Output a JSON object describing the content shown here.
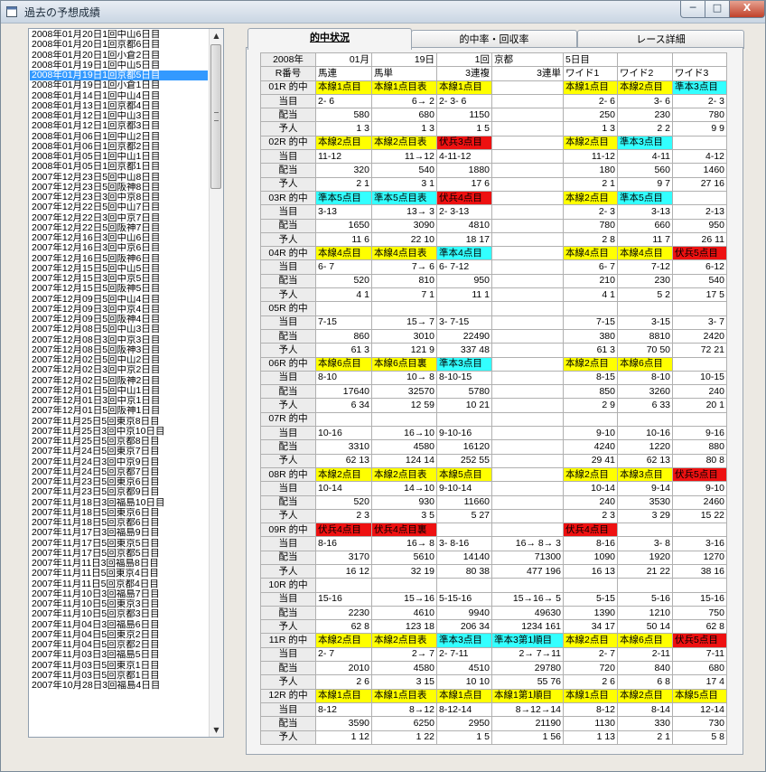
{
  "window": {
    "title": "過去の予想成績",
    "min_label": "─",
    "max_label": "□",
    "close_label": "X"
  },
  "race_list": [
    "2008年01月20日1回中山6日目",
    "2008年01月20日1回京都6日目",
    "2008年01月20日1回小倉2日目",
    "2008年01月19日1回中山5日目",
    "2008年01月19日1回京都5日目",
    "2008年01月19日1回小倉1日目",
    "2008年01月14日1回中山4日目",
    "2008年01月13日1回京都4日目",
    "2008年01月12日1回中山3日目",
    "2008年01月12日1回京都3日目",
    "2008年01月06日1回中山2日目",
    "2008年01月06日1回京都2日目",
    "2008年01月05日1回中山1日目",
    "2008年01月05日1回京都1日目",
    "2007年12月23日5回中山8日目",
    "2007年12月23日5回阪神8日目",
    "2007年12月23日3回中京8日目",
    "2007年12月22日5回中山7日目",
    "2007年12月22日3回中京7日目",
    "2007年12月22日5回阪神7日目",
    "2007年12月16日3回中山6日目",
    "2007年12月16日3回中京6日目",
    "2007年12月16日5回阪神6日目",
    "2007年12月15日5回中山5日目",
    "2007年12月15日3回中京5日目",
    "2007年12月15日5回阪神5日目",
    "2007年12月09日5回中山4日目",
    "2007年12月09日3回中京4日目",
    "2007年12月09日5回阪神4日目",
    "2007年12月08日5回中山3日目",
    "2007年12月08日3回中京3日目",
    "2007年12月08日5回阪神3日目",
    "2007年12月02日5回中山2日目",
    "2007年12月02日3回中京2日目",
    "2007年12月02日5回阪神2日目",
    "2007年12月01日5回中山1日目",
    "2007年12月01日3回中京1日目",
    "2007年12月01日5回阪神1日目",
    "2007年11月25日5回東京8日目",
    "2007年11月25日3回中京10日目",
    "2007年11月25日5回京都8日目",
    "2007年11月24日5回東京7日目",
    "2007年11月24日3回中京9日目",
    "2007年11月24日5回京都7日目",
    "2007年11月23日5回東京6日目",
    "2007年11月23日5回京都9日目",
    "2007年11月18日3回福島10日目",
    "2007年11月18日5回東京6日目",
    "2007年11月18日5回京都6日目",
    "2007年11月17日3回福島9日目",
    "2007年11月17日5回東京5日目",
    "2007年11月17日5回京都5日目",
    "2007年11月11日3回福島8日目",
    "2007年11月11日5回東京4日目",
    "2007年11月11日5回京都4日目",
    "2007年11月10日3回福島7日目",
    "2007年11月10日5回東京3日目",
    "2007年11月10日5回京都3日目",
    "2007年11月04日3回福島6日目",
    "2007年11月04日5回東京2日目",
    "2007年11月04日5回京都2日目",
    "2007年11月03日3回福島5日目",
    "2007年11月03日5回東京1日目",
    "2007年11月03日5回京都1日目",
    "2007年10月28日3回福島4日目"
  ],
  "selected_index": 4,
  "tabs": [
    {
      "label": "的中状況"
    },
    {
      "label": "的中率・回収率"
    },
    {
      "label": "レース詳細"
    }
  ],
  "header_rows": [
    [
      "2008年",
      "01月",
      "19日",
      "1回",
      "京都",
      "",
      "5日目",
      "",
      ""
    ],
    [
      "R番号",
      "馬連",
      "馬単",
      "3連複",
      "",
      "3連単",
      "ワイド1",
      "ワイド2",
      "ワイド3"
    ]
  ],
  "races": [
    {
      "label": "01R 的中",
      "hits": [
        [
          "y",
          "本線1点目"
        ],
        [
          "y",
          "本線1点目表"
        ],
        [
          "y",
          "本線1点目"
        ],
        [
          "",
          ""
        ],
        [
          "y",
          "本線1点目"
        ],
        [
          "y",
          "本線2点目"
        ],
        [
          "c",
          "準本3点目"
        ]
      ],
      "atari": [
        "2- 6",
        "6→ 2",
        "2- 3- 6",
        "",
        "2- 6",
        "3- 6",
        "2- 3"
      ],
      "haito": [
        "580",
        "680",
        "1150",
        "",
        "250",
        "230",
        "780"
      ],
      "ninki": [
        "1 3",
        "1 3",
        "1 5",
        "",
        "1 3",
        "2 2",
        "9 9"
      ]
    },
    {
      "label": "02R 的中",
      "hits": [
        [
          "y",
          "本線2点目"
        ],
        [
          "y",
          "本線2点目表"
        ],
        [
          "x",
          "伏兵3点目"
        ],
        [
          "",
          ""
        ],
        [
          "y",
          "本線2点目"
        ],
        [
          "c",
          "準本3点目"
        ],
        [
          "",
          ""
        ]
      ],
      "atari": [
        "11-12",
        "11→12",
        "4-11-12",
        "",
        "11-12",
        "4-11",
        "4-12"
      ],
      "haito": [
        "320",
        "540",
        "1880",
        "",
        "180",
        "560",
        "1460"
      ],
      "ninki": [
        "2 1",
        "3 1",
        "17 6",
        "",
        "2 1",
        "9 7",
        "27 16"
      ]
    },
    {
      "label": "03R 的中",
      "hits": [
        [
          "c",
          "準本5点目"
        ],
        [
          "c",
          "準本5点目表"
        ],
        [
          "x",
          "伏兵4点目"
        ],
        [
          "",
          ""
        ],
        [
          "y",
          "本線2点目"
        ],
        [
          "c",
          "準本5点目"
        ],
        [
          "",
          ""
        ]
      ],
      "atari": [
        "3-13",
        "13→ 3",
        "2- 3-13",
        "",
        "2- 3",
        "3-13",
        "2-13"
      ],
      "haito": [
        "1650",
        "3090",
        "4810",
        "",
        "780",
        "660",
        "950"
      ],
      "ninki": [
        "11 6",
        "22 10",
        "18 17",
        "",
        "2 8",
        "11 7",
        "26 11"
      ]
    },
    {
      "label": "04R 的中",
      "hits": [
        [
          "y",
          "本線4点目"
        ],
        [
          "y",
          "本線4点目表"
        ],
        [
          "c",
          "準本4点目"
        ],
        [
          "",
          ""
        ],
        [
          "y",
          "本線4点目"
        ],
        [
          "y",
          "本線4点目"
        ],
        [
          "x",
          "伏兵5点目"
        ]
      ],
      "atari": [
        "6- 7",
        "7→ 6",
        "6- 7-12",
        "",
        "6- 7",
        "7-12",
        "6-12"
      ],
      "haito": [
        "520",
        "810",
        "950",
        "",
        "210",
        "230",
        "540"
      ],
      "ninki": [
        "4 1",
        "7 1",
        "11 1",
        "",
        "4 1",
        "5 2",
        "17 5"
      ]
    },
    {
      "label": "05R 的中",
      "hits": [
        [
          "",
          ""
        ],
        [
          "",
          ""
        ],
        [
          "",
          ""
        ],
        [
          "",
          ""
        ],
        [
          "",
          ""
        ],
        [
          "",
          ""
        ],
        [
          "",
          ""
        ]
      ],
      "atari": [
        "7-15",
        "15→ 7",
        "3- 7-15",
        "",
        "7-15",
        "3-15",
        "3- 7"
      ],
      "haito": [
        "860",
        "3010",
        "22490",
        "",
        "380",
        "8810",
        "2420"
      ],
      "ninki": [
        "61 3",
        "121 9",
        "337 48",
        "",
        "61 3",
        "70 50",
        "72 21"
      ]
    },
    {
      "label": "06R 的中",
      "hits": [
        [
          "y",
          "本線6点目"
        ],
        [
          "y",
          "本線6点目裏"
        ],
        [
          "c",
          "準本3点目"
        ],
        [
          "",
          ""
        ],
        [
          "y",
          "本線2点目"
        ],
        [
          "y",
          "本線6点目"
        ],
        [
          "",
          ""
        ]
      ],
      "atari": [
        "8-10",
        "10→ 8",
        "8-10-15",
        "",
        "8-15",
        "8-10",
        "10-15"
      ],
      "haito": [
        "17640",
        "32570",
        "5780",
        "",
        "850",
        "3260",
        "240"
      ],
      "ninki": [
        "6 34",
        "12 59",
        "10 21",
        "",
        "2 9",
        "6 33",
        "20 1"
      ]
    },
    {
      "label": "07R 的中",
      "hits": [
        [
          "",
          ""
        ],
        [
          "",
          ""
        ],
        [
          "",
          ""
        ],
        [
          "",
          ""
        ],
        [
          "",
          ""
        ],
        [
          "",
          ""
        ],
        [
          "",
          ""
        ]
      ],
      "atari": [
        "10-16",
        "16→10",
        "9-10-16",
        "",
        "9-10",
        "10-16",
        "9-16"
      ],
      "haito": [
        "3310",
        "4580",
        "16120",
        "",
        "4240",
        "1220",
        "880"
      ],
      "ninki": [
        "62 13",
        "124 14",
        "252 55",
        "",
        "29 41",
        "62 13",
        "80 8"
      ]
    },
    {
      "label": "08R 的中",
      "hits": [
        [
          "y",
          "本線2点目"
        ],
        [
          "y",
          "本線2点目表"
        ],
        [
          "y",
          "本線5点目"
        ],
        [
          "",
          ""
        ],
        [
          "y",
          "本線2点目"
        ],
        [
          "y",
          "本線3点目"
        ],
        [
          "x",
          "伏兵5点目"
        ]
      ],
      "atari": [
        "10-14",
        "14→10",
        "9-10-14",
        "",
        "10-14",
        "9-14",
        "9-10"
      ],
      "haito": [
        "520",
        "930",
        "11660",
        "",
        "240",
        "3530",
        "2460"
      ],
      "ninki": [
        "2 3",
        "3 5",
        "5 27",
        "",
        "2 3",
        "3 29",
        "15 22"
      ]
    },
    {
      "label": "09R 的中",
      "hits": [
        [
          "x",
          "伏兵4点目"
        ],
        [
          "x",
          "伏兵4点目裏"
        ],
        [
          "",
          ""
        ],
        [
          "",
          ""
        ],
        [
          "x",
          "伏兵4点目"
        ],
        [
          "",
          ""
        ],
        [
          "",
          ""
        ]
      ],
      "atari": [
        "8-16",
        "16→ 8",
        "3- 8-16",
        "16→ 8→ 3",
        "8-16",
        "3- 8",
        "3-16"
      ],
      "haito": [
        "3170",
        "5610",
        "14140",
        "71300",
        "1090",
        "1920",
        "1270"
      ],
      "ninki": [
        "16 12",
        "32 19",
        "80 38",
        "477 196",
        "16 13",
        "21 22",
        "38 16"
      ]
    },
    {
      "label": "10R 的中",
      "hits": [
        [
          "",
          ""
        ],
        [
          "",
          ""
        ],
        [
          "",
          ""
        ],
        [
          "",
          ""
        ],
        [
          "",
          ""
        ],
        [
          "",
          ""
        ],
        [
          "",
          ""
        ]
      ],
      "atari": [
        "15-16",
        "15→16",
        "5-15-16",
        "15→16→ 5",
        "5-15",
        "5-16",
        "15-16"
      ],
      "haito": [
        "2230",
        "4610",
        "9940",
        "49630",
        "1390",
        "1210",
        "750"
      ],
      "ninki": [
        "62 8",
        "123 18",
        "206 34",
        "1234 161",
        "34 17",
        "50 14",
        "62 8"
      ]
    },
    {
      "label": "11R 的中",
      "hits": [
        [
          "y",
          "本線2点目"
        ],
        [
          "y",
          "本線2点目表"
        ],
        [
          "c",
          "準本3点目"
        ],
        [
          "c",
          "準本3第1順目"
        ],
        [
          "y",
          "本線2点目"
        ],
        [
          "y",
          "本線6点目"
        ],
        [
          "x",
          "伏兵5点目"
        ]
      ],
      "atari": [
        "2- 7",
        "2→ 7",
        "2- 7-11",
        "2→ 7→11",
        "2- 7",
        "2-11",
        "7-11"
      ],
      "haito": [
        "2010",
        "4580",
        "4510",
        "29780",
        "720",
        "840",
        "680"
      ],
      "ninki": [
        "2 6",
        "3 15",
        "10 10",
        "55 76",
        "2 6",
        "6 8",
        "17 4"
      ]
    },
    {
      "label": "12R 的中",
      "hits": [
        [
          "y",
          "本線1点目"
        ],
        [
          "y",
          "本線1点目表"
        ],
        [
          "y",
          "本線1点目"
        ],
        [
          "y",
          "本線1第1順目"
        ],
        [
          "y",
          "本線1点目"
        ],
        [
          "y",
          "本線2点目"
        ],
        [
          "y",
          "本線5点目"
        ]
      ],
      "atari": [
        "8-12",
        "8→12",
        "8-12-14",
        "8→12→14",
        "8-12",
        "8-14",
        "12-14"
      ],
      "haito": [
        "3590",
        "6250",
        "2950",
        "21190",
        "1130",
        "330",
        "730"
      ],
      "ninki": [
        "1 12",
        "1 22",
        "1 5",
        "1 56",
        "1 13",
        "2 1",
        "5 8"
      ]
    }
  ],
  "row_labels": {
    "atari": "当目",
    "haito": "配当",
    "ninki": "予人"
  },
  "colors": {
    "honsen": "#ffff00",
    "junhon": "#33ffff",
    "fukuhei": "#ee1111",
    "selection": "#3399ff"
  }
}
